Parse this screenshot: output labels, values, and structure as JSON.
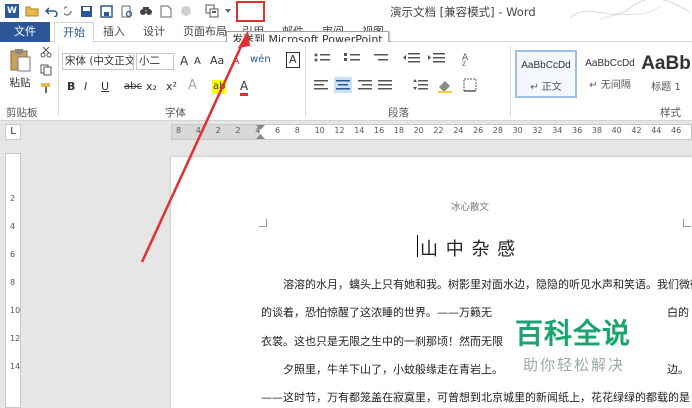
{
  "window": {
    "title": "演示文档 [兼容模式] - Word"
  },
  "qat": {
    "icons": [
      "word-logo",
      "open-icon",
      "undo-icon",
      "redo-icon",
      "save-icon",
      "save-as-icon",
      "print-preview-icon",
      "find-icon",
      "new-icon",
      "circle-icon",
      "send-to-powerpoint-icon",
      "dropdown-icon"
    ],
    "word_logo_text": "W"
  },
  "tooltip": {
    "text": "发送到 Microsoft PowerPoint"
  },
  "tabs": {
    "file": "文件",
    "home": "开始",
    "insert": "插入",
    "design": "设计",
    "layout": "页面布局",
    "references": "引用",
    "mailings": "邮件",
    "review": "审阅",
    "view": "视图"
  },
  "clipboard": {
    "paste": "粘贴",
    "label": "剪贴板"
  },
  "font": {
    "name": "宋体 (中文正文)",
    "size": "小二",
    "label": "字体",
    "bold": "B",
    "italic": "I",
    "underline": "U",
    "strike": "abc",
    "sub": "x₂",
    "sup": "x²",
    "grow": "A",
    "shrink": "A",
    "case": "Aa",
    "clear": "A",
    "phonetic": "wén",
    "border_char": "A",
    "highlight": "ab",
    "font_color": "A"
  },
  "paragraph": {
    "label": "段落"
  },
  "styles": {
    "label": "样式",
    "items": [
      {
        "sample": "AaBbCcDd",
        "name": "↵ 正文"
      },
      {
        "sample": "AaBbCcDd",
        "name": "↵ 无间隔"
      },
      {
        "sample": "AaBb",
        "name": "标题 1"
      }
    ]
  },
  "ruler": {
    "tab_marker": "L",
    "h_ticks": [
      "8",
      "4",
      "2",
      "2",
      "4",
      "6",
      "8",
      "10",
      "12",
      "14",
      "16",
      "18",
      "20",
      "22",
      "24",
      "26",
      "28",
      "30",
      "32",
      "34",
      "36",
      "38",
      "40",
      "42",
      "44",
      "46"
    ],
    "v_ticks": [
      "2",
      "4",
      "6",
      "8",
      "10",
      "12",
      "14"
    ]
  },
  "document": {
    "header": "冰心散文",
    "title": "山 中 杂 感",
    "paragraphs": [
      "溶溶的水月，螭头上只有她和我。树影里对面水边，隐隐的听见水声和笑语。我们微微",
      "的谈着，恐怕惊醒了这浓睡的世界。——万籁无",
      "衣裳。这也只是无限之生中的一刹那顷！然而无限",
      "夕照里，牛羊下山了，小蚊般缘走在青岩上。",
      "——这时节，万有都笼盖在寂寞里，可曾想到北京城里的新闻纸上，花花绿绿的都载的是"
    ],
    "right_fragments": [
      "白的",
      "边。"
    ]
  },
  "watermark": {
    "main": "百科全说",
    "sub": "助你轻松解决",
    "color": "#17a46d"
  },
  "colors": {
    "accent": "#2b579a",
    "arrow": "#e03030",
    "highlight_yellow": "#ffff00",
    "font_red": "#e03030"
  }
}
